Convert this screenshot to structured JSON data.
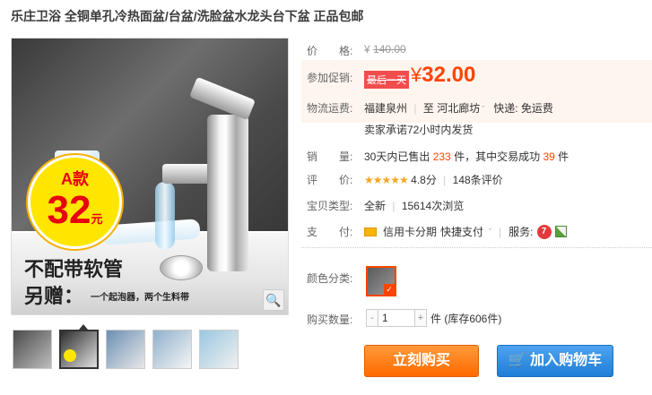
{
  "product": {
    "title": "乐庄卫浴 全铜单孔冷热面盆/台盆/洗脸盆水龙头台下盆 正品包邮"
  },
  "image": {
    "badge_top": "A款",
    "badge_price": "32",
    "badge_unit": "元",
    "promo_line1": "不配带软管",
    "promo_line2": "另赠：",
    "promo_line3": "一个起泡器，两个生料带",
    "zoom_icon": "magnifier-icon"
  },
  "thumbnails": [
    {
      "name": "thumb-1",
      "active": false
    },
    {
      "name": "thumb-2",
      "active": true
    },
    {
      "name": "thumb-3",
      "active": false
    },
    {
      "name": "thumb-4",
      "active": false
    },
    {
      "name": "thumb-5",
      "active": false
    }
  ],
  "labels": {
    "price": "价　　格:",
    "promo": "参加促销:",
    "shipping": "物流运费:",
    "sales": "销　　量:",
    "rating": "评　　价:",
    "status": "宝贝类型:",
    "payment": "支　　付:",
    "color": "颜色分类:",
    "quantity": "购买数量:"
  },
  "price": {
    "currency": "¥",
    "original": "140.00",
    "promo_tag": "最后一天",
    "current": "32.00"
  },
  "shipping": {
    "from": "福建泉州",
    "to_word": "至",
    "to": "河北廊坊",
    "fee_label": "快递:",
    "fee": "免运费",
    "promise": "卖家承诺72小时内发货"
  },
  "sales": {
    "prefix": "30天内已售出",
    "sold": "233",
    "unit1": "件，其中交易成功",
    "success": "39",
    "unit2": "件"
  },
  "rating": {
    "stars": "★★★★★",
    "score": "4.8分",
    "sep": "|",
    "count_text": "148条评价"
  },
  "status": {
    "condition": "全新",
    "sep": "|",
    "views": "15614次浏览"
  },
  "payment": {
    "card": "信用卡分期",
    "quick": "快捷支付",
    "service_label": "服务:",
    "service_icon_text": "7"
  },
  "quantity": {
    "value": "1",
    "minus": "-",
    "plus": "+",
    "unit": "件 (库存606件)"
  },
  "buttons": {
    "buy": "立刻购买",
    "cart": "加入购物车",
    "cart_icon": "cart-icon"
  },
  "colors": {
    "accent": "#ff4400",
    "buy": "#ff6a00",
    "cart": "#1e7ed6",
    "promo_bg": "#fff5ef",
    "star": "#f5a623"
  }
}
